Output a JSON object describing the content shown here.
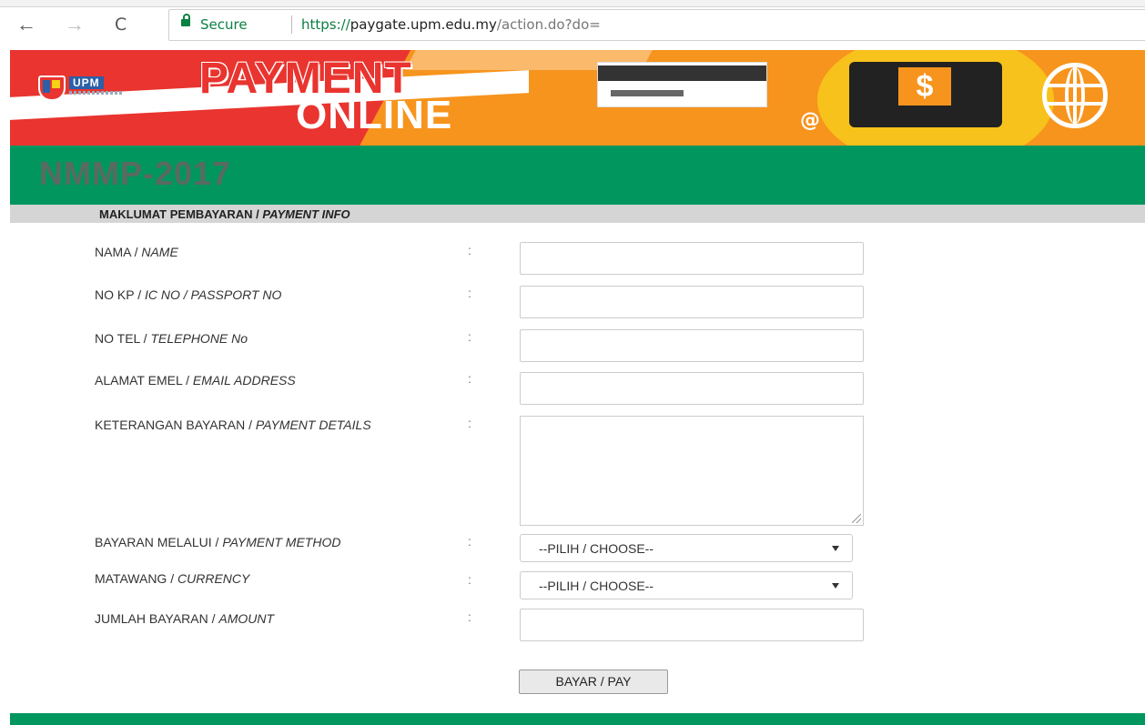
{
  "browser": {
    "back_icon": "←",
    "forward_icon": "→",
    "reload_icon": "C",
    "secure_label": "Secure",
    "url_scheme": "https://",
    "url_host": "paygate.upm.edu.my",
    "url_path": "/action.do?do="
  },
  "banner": {
    "logo_text": "UPM",
    "title_line1": "PAYMENT",
    "title_line2": "ONLINE",
    "at_symbol": "@",
    "dollar_symbol": "$"
  },
  "event_code": "NMMP-2017",
  "section": {
    "title_main": "MAKLUMAT PEMBAYARAN",
    "title_sep": " / ",
    "title_en": "PAYMENT INFO"
  },
  "form": {
    "name_label": "NAMA",
    "name_label_en": "NAME",
    "ic_label": "NO KP",
    "ic_label_en": "IC NO / PASSPORT NO",
    "tel_label": "NO TEL",
    "tel_label_en": "TELEPHONE No",
    "email_label": "ALAMAT EMEL",
    "email_label_en": "EMAIL ADDRESS",
    "details_label": "KETERANGAN BAYARAN",
    "details_label_en": "PAYMENT DETAILS",
    "method_label": "BAYARAN MELALUI",
    "method_label_en": "PAYMENT METHOD",
    "currency_label": "MATAWANG",
    "currency_label_en": "CURRENCY",
    "amount_label": "JUMLAH BAYARAN",
    "amount_label_en": "AMOUNT",
    "slash": " / ",
    "colon": ":",
    "method_value": "--PILIH / CHOOSE--",
    "currency_value": "--PILIH / CHOOSE--",
    "submit_label": "BAYAR / PAY"
  }
}
